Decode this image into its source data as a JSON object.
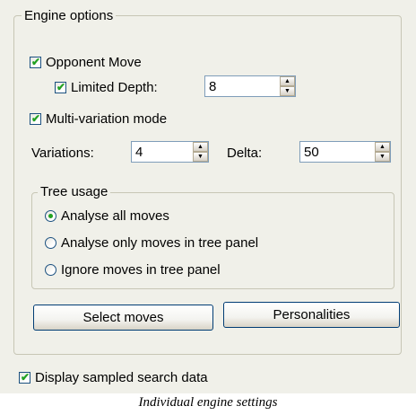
{
  "engine_options": {
    "title": "Engine options",
    "opponent_move": {
      "label": "Opponent Move",
      "checked": true
    },
    "limited_depth": {
      "label": "Limited Depth:",
      "checked": true,
      "value": "8"
    },
    "multi_variation": {
      "label": "Multi-variation mode",
      "checked": true
    },
    "variations": {
      "label": "Variations:",
      "value": "4"
    },
    "delta": {
      "label": "Delta:",
      "value": "50"
    },
    "tree_usage": {
      "title": "Tree usage",
      "options": [
        {
          "label": "Analyse all moves",
          "selected": true
        },
        {
          "label": "Analyse only moves in tree panel",
          "selected": false
        },
        {
          "label": "Ignore moves in tree panel",
          "selected": false
        }
      ]
    },
    "select_moves_button": "Select moves",
    "personalities_button": "Personalities"
  },
  "display_sampled": {
    "label": "Display sampled search data",
    "checked": true
  },
  "caption": "Individual engine settings",
  "colors": {
    "panel_bg": "#f0f0e9",
    "check_green": "#21a121",
    "border_blue": "#1c5180"
  },
  "icons": {
    "spin_up": "arrow-up-icon",
    "spin_down": "arrow-down-icon",
    "check": "checkmark-icon"
  }
}
